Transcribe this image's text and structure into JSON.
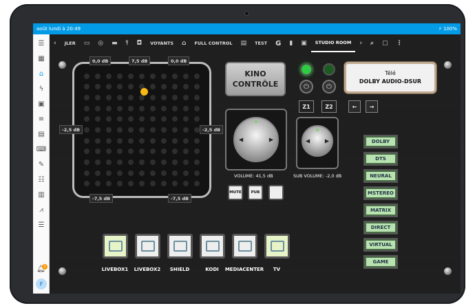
{
  "status": {
    "left": "août lundi à 20:49",
    "right": "100%"
  },
  "sidebar": {
    "avatar": "F",
    "notif_count": "2"
  },
  "tabs": {
    "back_partial": "JLER",
    "voyants": "VOYANTS",
    "full_control": "FULL CONTROL",
    "test": "TEST",
    "g": "G",
    "studio_room": "STUDIO ROOM"
  },
  "pad": {
    "top_left": "0,0 dB",
    "top_center": "7,5 dB",
    "top_right": "0,0 dB",
    "left": "-2,5 dB",
    "right": "-2,5 dB",
    "bottom_left": "-7,5 dB",
    "bottom_right": "-7,5 dB"
  },
  "kino": {
    "line1": "KINO",
    "line2": "CONTRÔLE"
  },
  "zones": {
    "z1": "Z1",
    "z2": "Z2"
  },
  "tele": {
    "line1": "Télé",
    "line2": "DOLBY AUDIO-DSUR"
  },
  "volume": {
    "main": "VOLUME: 41,5 dB",
    "sub": "SUB VOLUME: -2,0 dB"
  },
  "small_buttons": {
    "mute": "MUTE",
    "pub": "PUB",
    "blank": ""
  },
  "modes": [
    "DOLBY",
    "DTS",
    "NEURAL",
    "MSTEREO",
    "MATRIX",
    "DIRECT",
    "VIRTUAL",
    "GAME"
  ],
  "sources": [
    {
      "label": "LIVEBOX1",
      "bg": "#e6f4c8"
    },
    {
      "label": "LIVEBOX2",
      "bg": "#eeeeee"
    },
    {
      "label": "SHIELD",
      "bg": "#eeeeee"
    },
    {
      "label": "KODI",
      "bg": "#eeeeee"
    },
    {
      "label": "MEDIACENTER",
      "bg": "#eeeeee"
    },
    {
      "label": "TV",
      "bg": "#e6f4c8"
    }
  ],
  "colors": {
    "accent": "#039be5",
    "led_on": "#2ecc40",
    "led_off": "#1d5b22",
    "puck": "#f9b814"
  }
}
